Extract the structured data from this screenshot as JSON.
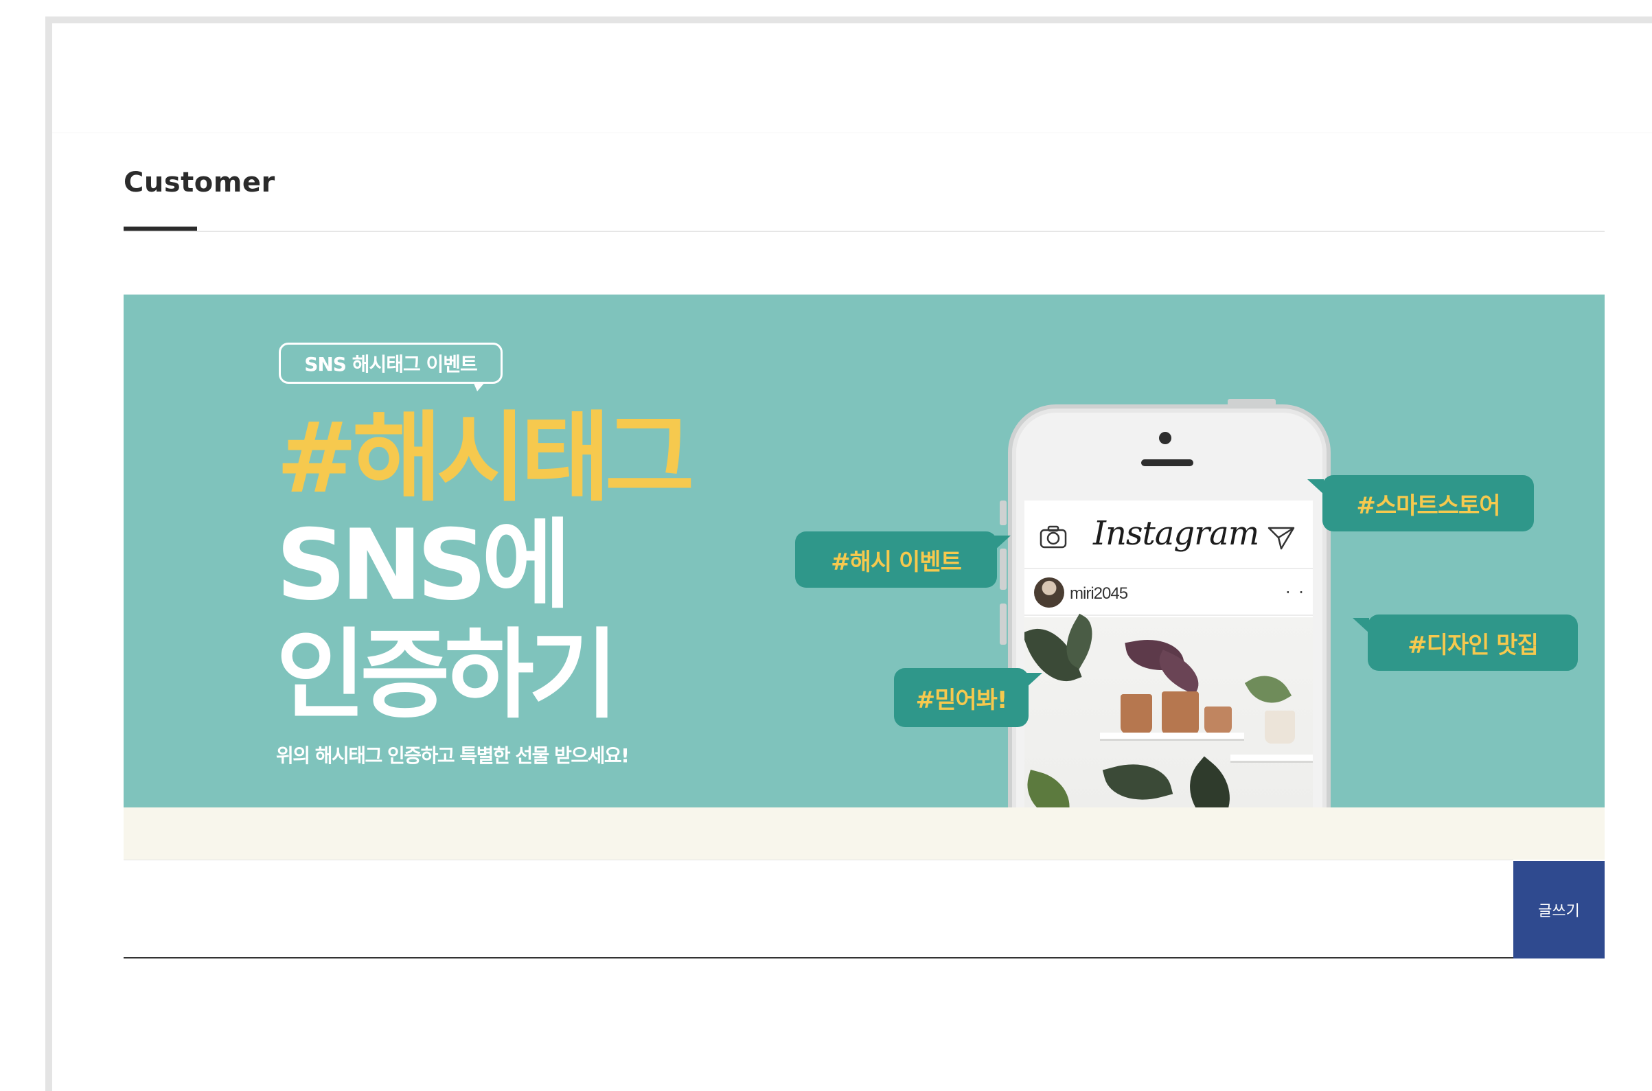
{
  "section": {
    "title": "Customer"
  },
  "banner": {
    "event_tag": "SNS 해시태그 이벤트",
    "headline_1": "#해시태그",
    "headline_2": "SNS에",
    "headline_3": "인증하기",
    "subline": "위의 해시태그 인증하고 특별한 선물 받으세요!",
    "hashtags": [
      "#해시 이벤트",
      "#스마트스토어",
      "#디자인 맛집",
      "#믿어봐!"
    ],
    "instagram": {
      "logo": "Instagram",
      "username": "miri2045",
      "more": "· ·"
    },
    "colors": {
      "background": "#7fc3bc",
      "headline_accent": "#f6c94e",
      "bubble": "#2f978a"
    }
  },
  "write": {
    "button_label": "글쓰기",
    "button_color": "#2f4a8f"
  }
}
